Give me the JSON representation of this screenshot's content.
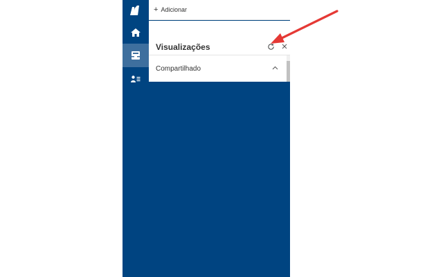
{
  "colors": {
    "rail": "#004481",
    "rail_active": "#3e6f9e",
    "panel_background": "#004481",
    "text": "#333333",
    "annotation_arrow": "#e53935"
  },
  "rail": {
    "items": [
      {
        "name": "logo",
        "icon": "app-logo-icon",
        "active": false
      },
      {
        "name": "home",
        "icon": "home-icon",
        "active": false
      },
      {
        "name": "views",
        "icon": "inbox-tray-icon",
        "active": true
      },
      {
        "name": "contacts",
        "icon": "contact-list-icon",
        "active": false
      }
    ]
  },
  "toolbar": {
    "add_icon": "+",
    "add_label": "Adicionar"
  },
  "views": {
    "title": "Visualizações",
    "refresh_icon": "refresh-icon",
    "close_icon": "close-icon",
    "sections": [
      {
        "label": "Compartilhado",
        "expanded": true,
        "chevron_icon": "chevron-up-icon"
      }
    ]
  }
}
